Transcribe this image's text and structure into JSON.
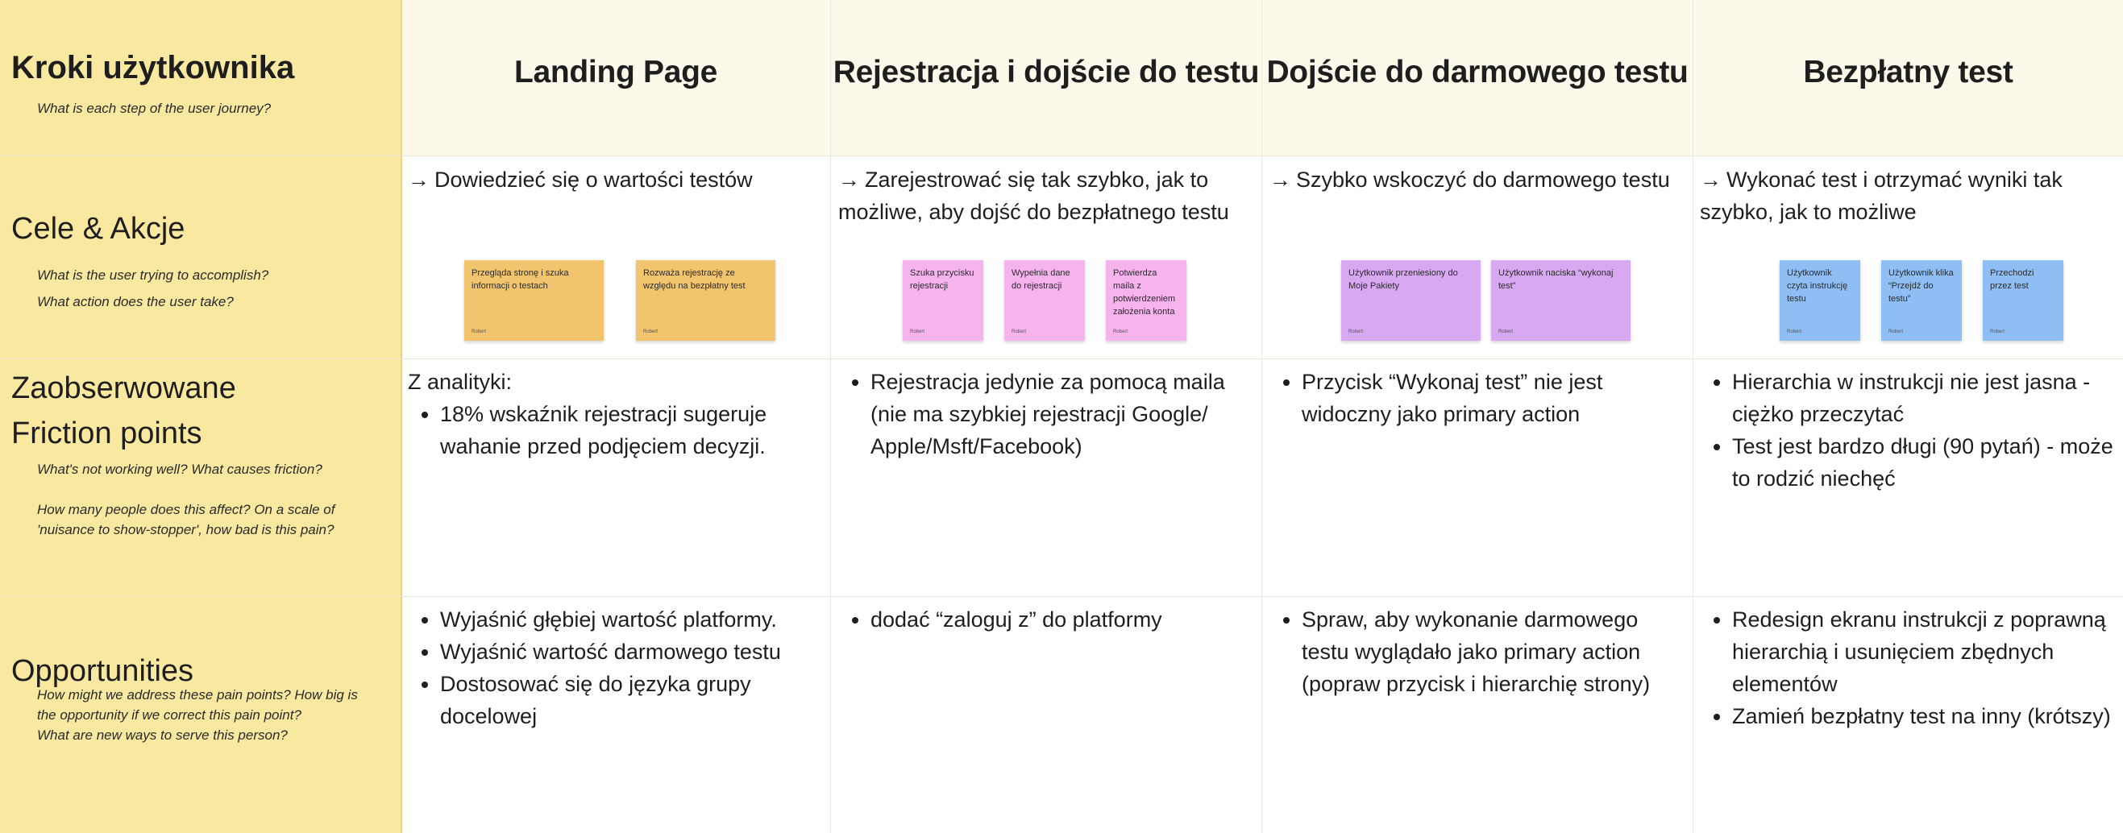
{
  "row_labels": {
    "steps": {
      "title": "Kroki użytkownika",
      "question": "What is each step of the user journey?"
    },
    "goals": {
      "title": "Cele & Akcje",
      "questions": [
        "What is the user trying to accomplish?",
        "What action does the user take?"
      ]
    },
    "friction": {
      "title_lines": [
        "Zaobserwowane",
        "Friction points"
      ],
      "questions": [
        "What's not working well? What causes friction?",
        "How many people does this affect? On a scale of 'nuisance to show-stopper', how bad is this pain?"
      ]
    },
    "opportunities": {
      "title": "Opportunities",
      "questions": [
        "How might we address these pain points? How big is the opportunity if we correct this pain point?",
        "What are new ways to serve this person?"
      ]
    }
  },
  "arrow_glyph": "→",
  "stages": [
    {
      "title": "Landing Page",
      "goal": "Dowiedzieć się o wartości testów",
      "notes": [
        {
          "text": "Przegląda stronę i szuka informacji o testach",
          "author": "Robert",
          "color": "#f2c46e"
        },
        {
          "text": "Rozważa rejestrację ze względu na bezpłatny test",
          "author": "Robert",
          "color": "#f2c46e"
        }
      ],
      "friction_intro": "Z analityki:",
      "friction": [
        "18% wskaźnik rejestracji sugeruje wahanie przed podjęciem decyzji."
      ],
      "opportunities": [
        "Wyjaśnić głębiej wartość platformy.",
        "Wyjaśnić wartość darmowego testu",
        "Dostosować się do języka grupy docelowej"
      ]
    },
    {
      "title": "Rejestracja i dojście do testu",
      "goal": "Zarejestrować się tak szybko, jak to możliwe, aby dojść do bezpłatnego testu",
      "notes": [
        {
          "text": "Szuka przycisku rejestracji",
          "author": "Robert",
          "color": "#f6b3ee"
        },
        {
          "text": "Wypełnia dane do rejestracji",
          "author": "Robert",
          "color": "#f6b3ee"
        },
        {
          "text": "Potwierdza maila z potwierdzeniem założenia konta",
          "author": "Robert",
          "color": "#f6b3ee"
        }
      ],
      "friction_intro": "",
      "friction": [
        "Rejestracja jedynie za pomocą maila (nie ma szybkiej rejestracji Google/ Apple/Msft/Facebook)"
      ],
      "opportunities": [
        "dodać “zaloguj z” do platformy"
      ]
    },
    {
      "title": "Dojście do darmowego testu",
      "goal": "Szybko wskoczyć do darmowego testu",
      "notes": [
        {
          "text": "Użytkownik przeniesiony do Moje Pakiety",
          "author": "Robert",
          "color": "#d8a9f2"
        },
        {
          "text": "Użytkownik naciska “wykonaj test”",
          "author": "Robert",
          "color": "#d8a9f2"
        }
      ],
      "friction_intro": "",
      "friction": [
        "Przycisk “Wykonaj test” nie jest widoczny jako primary action"
      ],
      "opportunities": [
        "Spraw, aby wykonanie darmowego testu wyglądało jako primary action (popraw przycisk i hierarchię strony)"
      ]
    },
    {
      "title": "Bezpłatny test",
      "goal": "Wykonać test i otrzymać wyniki tak szybko, jak to możliwe",
      "notes": [
        {
          "text": "Użytkownik czyta instrukcję testu",
          "author": "Robert",
          "color": "#8fbef4"
        },
        {
          "text": "Użytkownik klika “Przejdź do testu”",
          "author": "Robert",
          "color": "#8fbef4"
        },
        {
          "text": "Przechodzi przez test",
          "author": "Robert",
          "color": "#8fbef4"
        }
      ],
      "friction_intro": "",
      "friction": [
        "Hierarchia w instrukcji nie jest jasna - ciężko przeczytać",
        "Test jest bardzo długi (90 pytań) - może to rodzić niechęć"
      ],
      "opportunities": [
        "Redesign ekranu instrukcji z poprawną hierarchią i usunięciem zbędnych elementów",
        "Zamień bezpłatny test na inny (krótszy)"
      ]
    }
  ]
}
